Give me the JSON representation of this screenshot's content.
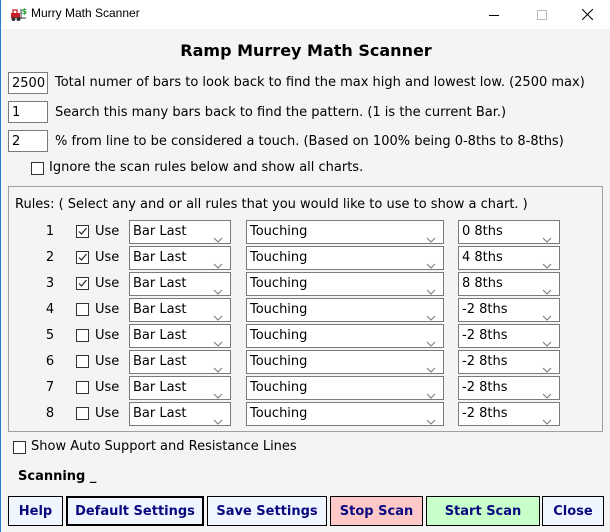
{
  "window": {
    "title": "Murry Math Scanner",
    "icon": "forklift-dollar-icon",
    "controls": [
      "minimize-icon",
      "maximize-icon",
      "close-icon"
    ]
  },
  "header": {
    "title": "Ramp Murrey Math Scanner"
  },
  "settings": {
    "lookback_bars": {
      "value": "2500",
      "label": "Total numer of bars to look back to find the max high and lowest low. (2500 max)"
    },
    "search_bars": {
      "value": "1",
      "label": "Search this many bars back to find the pattern. (1 is the current Bar.)"
    },
    "touch_percent": {
      "value": "2",
      "label": "% from line to be considered a touch. (Based on 100% being 0-8ths to 8-8ths)"
    },
    "ignore_rules": {
      "checked": false,
      "label": "Ignore the scan rules below and show all charts."
    }
  },
  "rules": {
    "header": "Rules:  ( Select any and or all rules that you would like to use to show a chart. )",
    "use_label": "Use",
    "items": [
      {
        "num": "1",
        "use": true,
        "bar": "Bar Last",
        "condition": "Touching",
        "level": "0 8ths"
      },
      {
        "num": "2",
        "use": true,
        "bar": "Bar Last",
        "condition": "Touching",
        "level": "4 8ths"
      },
      {
        "num": "3",
        "use": true,
        "bar": "Bar Last",
        "condition": "Touching",
        "level": "8 8ths"
      },
      {
        "num": "4",
        "use": false,
        "bar": "Bar Last",
        "condition": "Touching",
        "level": "-2 8ths"
      },
      {
        "num": "5",
        "use": false,
        "bar": "Bar Last",
        "condition": "Touching",
        "level": "-2 8ths"
      },
      {
        "num": "6",
        "use": false,
        "bar": "Bar Last",
        "condition": "Touching",
        "level": "-2 8ths"
      },
      {
        "num": "7",
        "use": false,
        "bar": "Bar Last",
        "condition": "Touching",
        "level": "-2 8ths"
      },
      {
        "num": "8",
        "use": false,
        "bar": "Bar Last",
        "condition": "Touching",
        "level": "-2 8ths"
      }
    ]
  },
  "auto_lines": {
    "checked": false,
    "label": "Show Auto Support and Resistance Lines"
  },
  "status": {
    "text": "Scanning _"
  },
  "buttons": {
    "help": {
      "label": "Help",
      "color": "#f0f6ff"
    },
    "default_settings": {
      "label": "Default Settings",
      "color": "#f0f6ff"
    },
    "save_settings": {
      "label": "Save Settings",
      "color": "#f0f6ff"
    },
    "stop_scan": {
      "label": "Stop Scan",
      "color": "#ffc8c8"
    },
    "start_scan": {
      "label": "Start Scan",
      "color": "#c8ffc8"
    },
    "close": {
      "label": "Close",
      "color": "#f0f6ff"
    }
  },
  "colors": {
    "button_text": "#0a0a80",
    "window_border": "#2b7cd3"
  }
}
